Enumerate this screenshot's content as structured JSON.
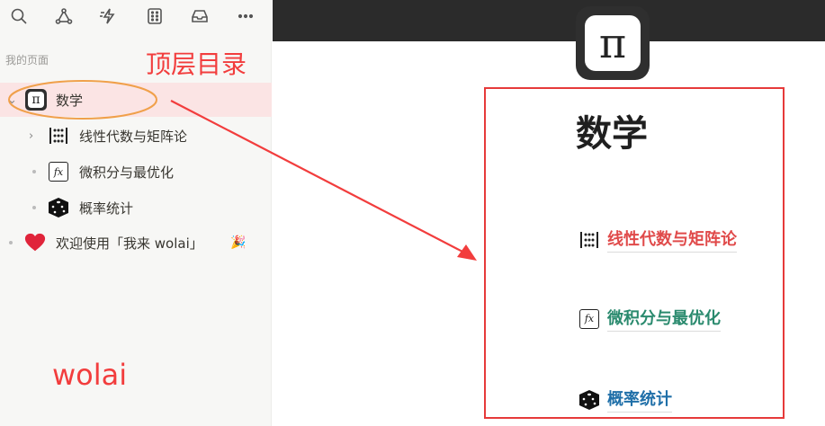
{
  "toolbar": {
    "icons": [
      "search-icon",
      "graph-icon",
      "lightning-icon",
      "grid-icon",
      "inbox-icon",
      "more-icon"
    ]
  },
  "sidebar": {
    "section_label": "我的页面",
    "items": [
      {
        "label": "数学",
        "icon": "pi-icon",
        "expanded": true,
        "selected": true
      },
      {
        "label": "线性代数与矩阵论",
        "icon": "dots-grid-icon"
      },
      {
        "label": "微积分与最优化",
        "icon": "fx-icon"
      },
      {
        "label": "概率统计",
        "icon": "dice-icon"
      },
      {
        "label": "欢迎使用「我来 wolai」",
        "icon": "heart-icon",
        "emoji": "🎉"
      }
    ]
  },
  "annotations": {
    "top_label": "顶层目录",
    "bottom_label": "wolai",
    "color": "#f23d3d"
  },
  "page": {
    "title": "数学",
    "icon": "pi-icon",
    "icon_glyph": "π",
    "links": [
      {
        "label": "线性代数与矩阵论",
        "icon": "dots-grid-icon",
        "color": "#e04a4a"
      },
      {
        "label": "微积分与最优化",
        "icon": "fx-icon",
        "color": "#2a8a6e"
      },
      {
        "label": "概率统计",
        "icon": "dice-icon",
        "color": "#1f6fa8"
      }
    ]
  },
  "colors": {
    "selected_row": "#fbe4e4",
    "cover": "#2b2b2b",
    "highlight_box": "#e63a3a",
    "ellipse": "#f0a04a"
  }
}
